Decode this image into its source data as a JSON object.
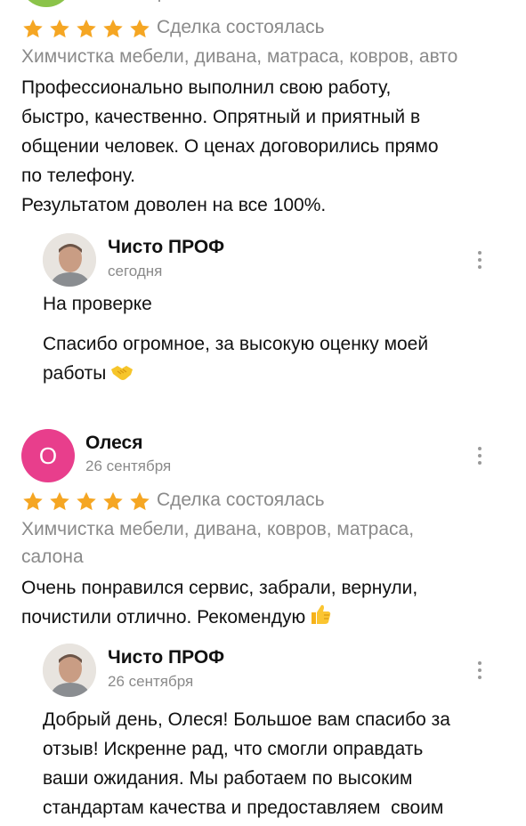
{
  "review1": {
    "deal_status": "Сделка состоялась",
    "service": "Химчистка мебели, дивана, матраса, ковров, авто",
    "text_lines": [
      "Профессионально выполнил свою работу,",
      "быстро, качественно. Опрятный и приятный в",
      "общении человек. О ценах договорились прямо",
      "по телефону.",
      "Результатом доволен на все 100%."
    ],
    "rating": 5,
    "reply": {
      "author": "Чисто ПРОФ",
      "date": "сегодня",
      "status": "На проверке",
      "text_lines": [
        "Спасибо огромное, за высокую оценку моей",
        "работы"
      ],
      "emoji": "handshake-emoji"
    }
  },
  "review2": {
    "author": "Олеся",
    "avatar_letter": "О",
    "avatar_color": "#e83e8c",
    "date": "26 сентября",
    "rating": 5,
    "deal_status": "Сделка состоялась",
    "service_lines": [
      "Химчистка мебели, дивана, ковров, матраса,",
      "салона"
    ],
    "text_lines": [
      "Очень понравился сервис, забрали, вернули,",
      "почистили отлично. Рекомендую"
    ],
    "emoji": "thumbs-up-emoji",
    "reply": {
      "author": "Чисто ПРОФ",
      "date": "26 сентября",
      "text_lines": [
        "Добрый день, Олеся! Большое вам спасибо за",
        "отзыв! Искренне рад, что смогли оправдать",
        "ваши ожидания. Мы работаем по высоким",
        "стандартам качества и предоставляем  своим"
      ]
    }
  },
  "colors": {
    "star": "#f5a623",
    "muted": "#8a8a8a",
    "top_avatar": "#8bc34a"
  }
}
